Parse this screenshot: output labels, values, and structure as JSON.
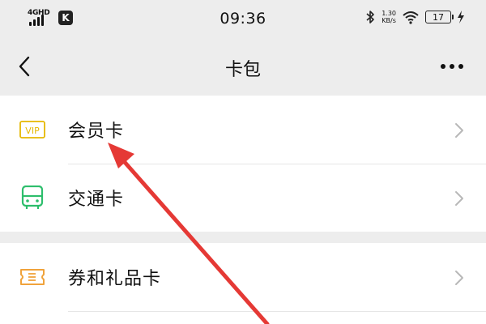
{
  "status_bar": {
    "network": "4GHD",
    "app_badge": "K",
    "time": "09:36",
    "speed_value": "1.30",
    "speed_unit": "KB/s",
    "battery": "17"
  },
  "nav": {
    "title": "卡包"
  },
  "menu": {
    "group1": [
      {
        "label": "会员卡",
        "icon": "vip-card-icon"
      },
      {
        "label": "交通卡",
        "icon": "bus-icon"
      }
    ],
    "group2": [
      {
        "label": "券和礼品卡",
        "icon": "ticket-icon"
      }
    ]
  },
  "colors": {
    "background": "#ededed",
    "vip_icon": "#e6b800",
    "transit_icon": "#2dbe6c",
    "coupon_icon": "#f0a33c",
    "annotation_arrow": "#e53935"
  }
}
